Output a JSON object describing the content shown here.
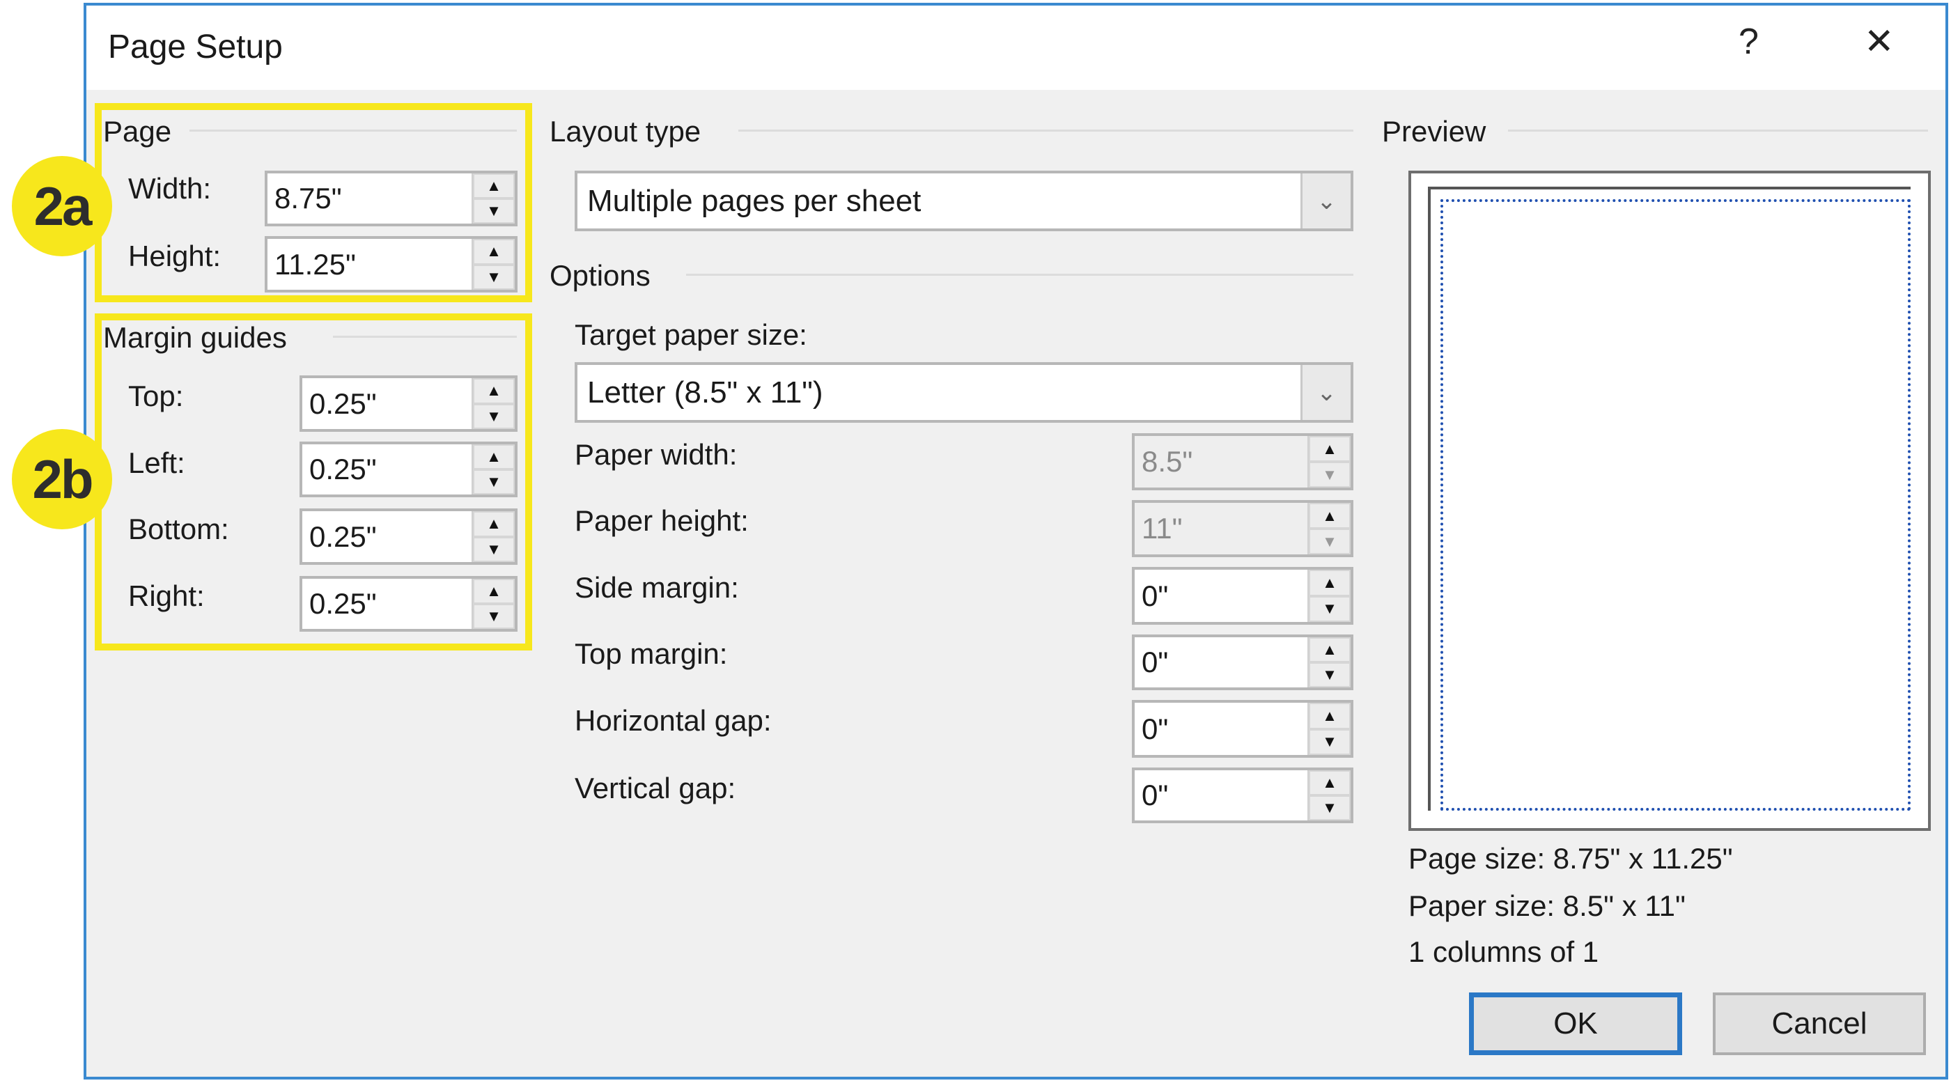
{
  "dialog": {
    "title": "Page Setup",
    "help": "?",
    "close": "✕"
  },
  "badges": {
    "a": "2a",
    "b": "2b"
  },
  "page": {
    "header": "Page",
    "width_label": "Width:",
    "width": "8.75\"",
    "height_label": "Height:",
    "height": "11.25\""
  },
  "margins": {
    "header": "Margin guides",
    "top_label": "Top:",
    "top": "0.25\"",
    "left_label": "Left:",
    "left": "0.25\"",
    "bottom_label": "Bottom:",
    "bottom": "0.25\"",
    "right_label": "Right:",
    "right": "0.25\""
  },
  "layout": {
    "header": "Layout type",
    "value": "Multiple pages per sheet"
  },
  "options": {
    "header": "Options",
    "target_label": "Target paper size:",
    "target": "Letter (8.5\" x 11\")",
    "paper_width_label": "Paper width:",
    "paper_width": "8.5\"",
    "paper_height_label": "Paper height:",
    "paper_height": "11\"",
    "side_margin_label": "Side margin:",
    "side_margin": "0\"",
    "top_margin_label": "Top margin:",
    "top_margin": "0\"",
    "hgap_label": "Horizontal gap:",
    "hgap": "0\"",
    "vgap_label": "Vertical gap:",
    "vgap": "0\""
  },
  "preview": {
    "header": "Preview",
    "page_size": "Page size: 8.75\" x 11.25\"",
    "paper_size": "Paper size: 8.5\" x 11\"",
    "columns": "1 columns of 1"
  },
  "buttons": {
    "ok": "OK",
    "cancel": "Cancel"
  },
  "spin": {
    "up": "▲",
    "down": "▼",
    "chevron": "⌄"
  }
}
